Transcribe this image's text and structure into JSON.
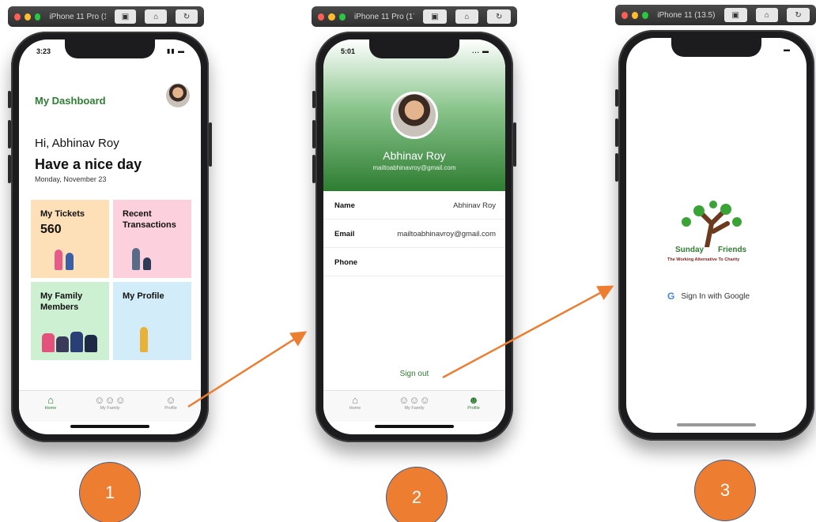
{
  "simulators": [
    {
      "title": "iPhone 11 Pro (17F..."
    },
    {
      "title": "iPhone 11 Pro (17F..."
    },
    {
      "title": "iPhone 11 (13.5)"
    }
  ],
  "screen1": {
    "time": "3:23",
    "status_icons": "▮▮ ▬",
    "title": "My Dashboard",
    "greeting": "Hi, Abhinav Roy",
    "headline": "Have a nice day",
    "date": "Monday, November 23",
    "tiles": [
      {
        "label": "My Tickets",
        "value": "560",
        "color": "#fde0b8"
      },
      {
        "label": "Recent Transactions",
        "value": "",
        "color": "#fcd0dd"
      },
      {
        "label": "My Family Members",
        "value": "",
        "color": "#cdf0d2"
      },
      {
        "label": "My Profile",
        "value": "",
        "color": "#d3ecfa"
      }
    ],
    "tabs": [
      {
        "label": "Home",
        "icon": "home-icon"
      },
      {
        "label": "My Family",
        "icon": "family-icon"
      },
      {
        "label": "Profile",
        "icon": "profile-icon"
      }
    ]
  },
  "screen2": {
    "time": "5:01",
    "status_icons": "... ▬",
    "name": "Abhinav Roy",
    "email": "mailtoabhinavroy@gmail.com",
    "fields": [
      {
        "key": "Name",
        "value": "Abhinav Roy"
      },
      {
        "key": "Email",
        "value": "mailtoabhinavroy@gmail.com"
      },
      {
        "key": "Phone",
        "value": ""
      }
    ],
    "signout": "Sign out",
    "tabs": [
      {
        "label": "Home",
        "icon": "home-icon"
      },
      {
        "label": "My Family",
        "icon": "family-icon"
      },
      {
        "label": "Profile",
        "icon": "profile-icon"
      }
    ]
  },
  "screen3": {
    "status_icons": "▬",
    "logo_word1": "Sunday",
    "logo_word2": "Friends",
    "logo_tagline": "The Working Alternative To Charity",
    "google_signin": "Sign In with Google",
    "google_letter": "G"
  },
  "steps": [
    "1",
    "2",
    "3"
  ],
  "colors": {
    "accent_green": "#2e7d32",
    "arrow": "#ed7d31",
    "badge": "#ed7d31"
  }
}
